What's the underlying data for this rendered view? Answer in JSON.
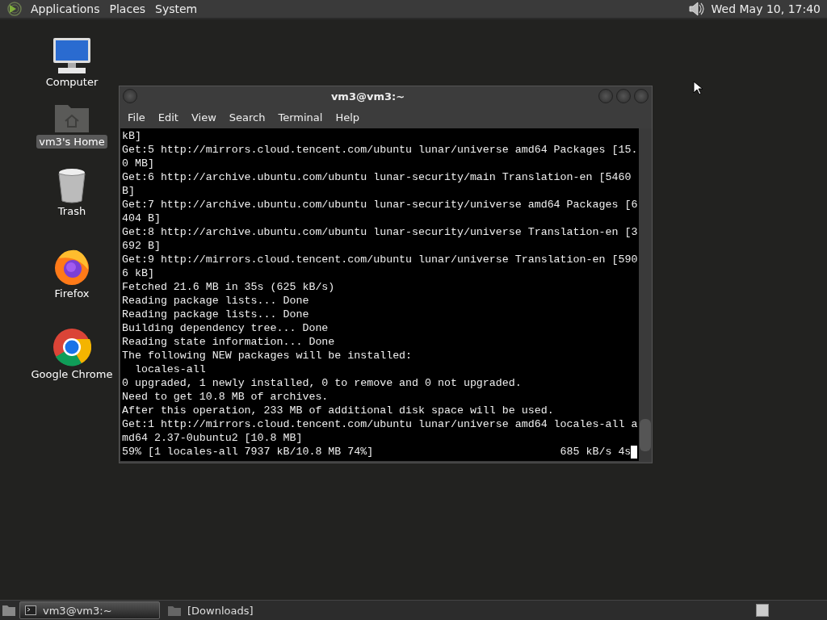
{
  "top_panel": {
    "menus": [
      "Applications",
      "Places",
      "System"
    ],
    "clock": "Wed May 10, 17:40"
  },
  "desktop_icons": [
    {
      "kind": "computer",
      "label": "Computer",
      "selected": false
    },
    {
      "kind": "home",
      "label": "vm3's Home",
      "selected": true
    },
    {
      "kind": "trash",
      "label": "Trash",
      "selected": false
    },
    {
      "kind": "firefox",
      "label": "Firefox",
      "selected": false
    },
    {
      "kind": "chrome",
      "label": "Google Chrome",
      "selected": false
    }
  ],
  "terminal": {
    "title": "vm3@vm3:~",
    "menu": [
      "File",
      "Edit",
      "View",
      "Search",
      "Terminal",
      "Help"
    ],
    "lines": [
      "kB]",
      "Get:5 http://mirrors.cloud.tencent.com/ubuntu lunar/universe amd64 Packages [15.",
      "0 MB]",
      "Get:6 http://archive.ubuntu.com/ubuntu lunar-security/main Translation-en [5460",
      "B]",
      "Get:7 http://archive.ubuntu.com/ubuntu lunar-security/universe amd64 Packages [6",
      "404 B]",
      "Get:8 http://archive.ubuntu.com/ubuntu lunar-security/universe Translation-en [3",
      "692 B]",
      "Get:9 http://mirrors.cloud.tencent.com/ubuntu lunar/universe Translation-en [590",
      "6 kB]",
      "Fetched 21.6 MB in 35s (625 kB/s)",
      "Reading package lists... Done",
      "Reading package lists... Done",
      "Building dependency tree... Done",
      "Reading state information... Done",
      "The following NEW packages will be installed:",
      "  locales-all",
      "0 upgraded, 1 newly installed, 0 to remove and 0 not upgraded.",
      "Need to get 10.8 MB of archives.",
      "After this operation, 233 MB of additional disk space will be used.",
      "Get:1 http://mirrors.cloud.tencent.com/ubuntu lunar/universe amd64 locales-all a",
      "md64 2.37-0ubuntu2 [10.8 MB]"
    ],
    "progress": "59% [1 locales-all 7937 kB/10.8 MB 74%]",
    "rate": "685 kB/s 4s"
  },
  "taskbar": [
    {
      "kind": "terminal",
      "label": "vm3@vm3:~",
      "selected": true
    },
    {
      "kind": "folder",
      "label": "[Downloads]",
      "selected": false
    }
  ]
}
